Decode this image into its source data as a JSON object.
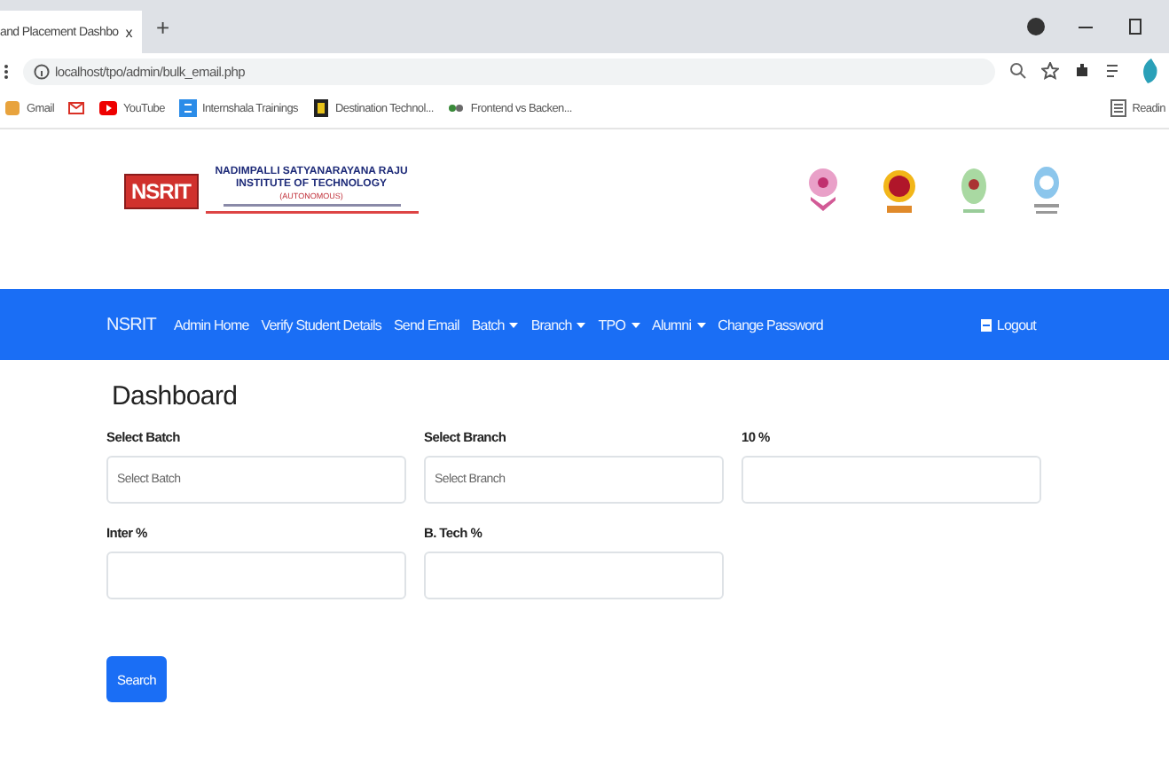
{
  "browser": {
    "tab_title": "and Placement Dashbo",
    "tab_close": "x",
    "new_tab": "+",
    "url": "localhost/tpo/admin/bulk_email.php",
    "bookmarks": [
      {
        "label": "Gmail",
        "kind": "star"
      },
      {
        "kind": "gmail"
      },
      {
        "label": "YouTube",
        "kind": "youtube"
      },
      {
        "label": "Internshala Trainings",
        "kind": "internshala"
      },
      {
        "label": "Destination Technol...",
        "kind": "dest"
      },
      {
        "label": "Frontend vs Backen...",
        "kind": "frontend"
      }
    ],
    "reading_list": "Readin"
  },
  "header": {
    "logo": "NSRIT",
    "name_line_1": "NADIMPALLI SATYANARAYANA RAJU",
    "name_line_2": "INSTITUTE OF TECHNOLOGY",
    "name_line_3": "(AUTONOMOUS)"
  },
  "navbar": {
    "brand": "NSRIT",
    "items": [
      {
        "label": "Admin Home",
        "dropdown": false
      },
      {
        "label": "Verify Student Details",
        "dropdown": false
      },
      {
        "label": "Send Email",
        "dropdown": false
      },
      {
        "label": "Batch",
        "dropdown": true
      },
      {
        "label": "Branch",
        "dropdown": true
      },
      {
        "label": "TPO",
        "dropdown": true
      },
      {
        "label": "Alumni",
        "dropdown": true
      },
      {
        "label": "Change Password",
        "dropdown": false
      }
    ],
    "logout": "Logout"
  },
  "page": {
    "title": "Dashboard",
    "fields": [
      {
        "label": "Select Batch",
        "placeholder": "Select Batch"
      },
      {
        "label": "Select Branch",
        "placeholder": "Select Branch"
      },
      {
        "label": "10 %"
      },
      {
        "label": "Inter %"
      },
      {
        "label": "B. Tech %"
      }
    ],
    "button": "Search"
  }
}
